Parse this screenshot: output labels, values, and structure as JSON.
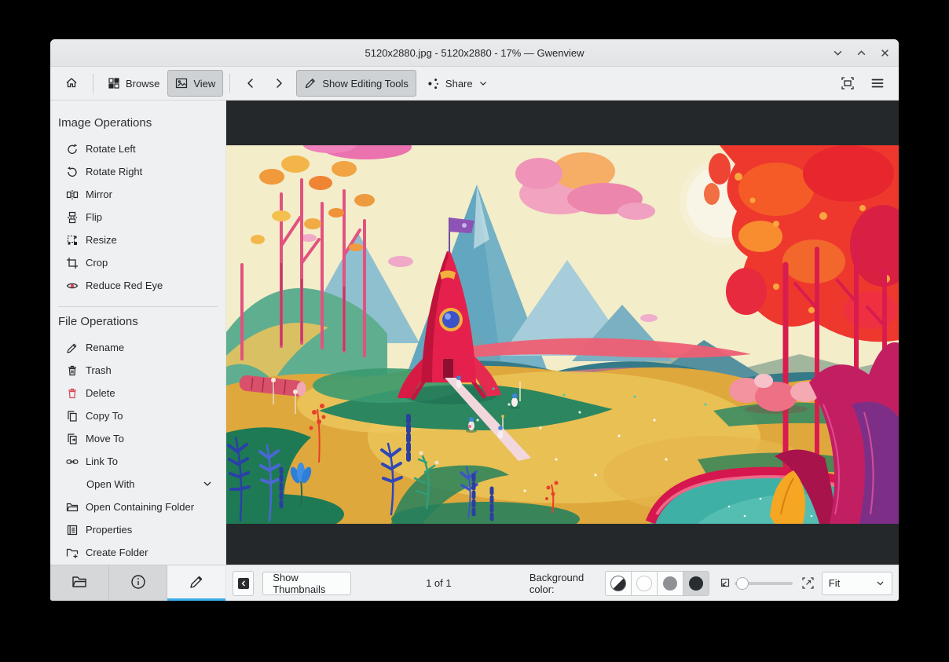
{
  "window": {
    "title": "5120x2880.jpg - 5120x2880 - 17% — Gwenview"
  },
  "toolbar": {
    "browse_label": "Browse",
    "view_label": "View",
    "editing_tools_label": "Show Editing Tools",
    "share_label": "Share"
  },
  "sidebar": {
    "image_operations": {
      "title": "Image Operations",
      "items": [
        {
          "label": "Rotate Left",
          "icon": "rotate-left-icon"
        },
        {
          "label": "Rotate Right",
          "icon": "rotate-right-icon"
        },
        {
          "label": "Mirror",
          "icon": "mirror-icon"
        },
        {
          "label": "Flip",
          "icon": "flip-icon"
        },
        {
          "label": "Resize",
          "icon": "resize-icon"
        },
        {
          "label": "Crop",
          "icon": "crop-icon"
        },
        {
          "label": "Reduce Red Eye",
          "icon": "reduce-red-eye-icon"
        }
      ]
    },
    "file_operations": {
      "title": "File Operations",
      "items": [
        {
          "label": "Rename",
          "icon": "rename-icon"
        },
        {
          "label": "Trash",
          "icon": "trash-icon"
        },
        {
          "label": "Delete",
          "icon": "delete-icon"
        },
        {
          "label": "Copy To",
          "icon": "copy-icon"
        },
        {
          "label": "Move To",
          "icon": "move-icon"
        },
        {
          "label": "Link To",
          "icon": "link-icon"
        },
        {
          "label": "Open With",
          "icon": "chevron-down-icon"
        },
        {
          "label": "Open Containing Folder",
          "icon": "folder-open-icon"
        },
        {
          "label": "Properties",
          "icon": "properties-icon"
        },
        {
          "label": "Create Folder",
          "icon": "create-folder-icon"
        }
      ]
    }
  },
  "statusbar": {
    "show_thumbnails_label": "Show Thumbnails",
    "page_indicator": "1 of 1",
    "background_color_label": "Background color:",
    "zoom_mode_value": "Fit"
  },
  "colors": {
    "accent": "#3daee9",
    "delete_red": "#da4453",
    "viewer_background": "#24282b",
    "chrome_background": "#eff0f1",
    "background_swatches": [
      "auto-half-black-white",
      "#ffffff",
      "#8f9294",
      "#2a2d30"
    ]
  },
  "icons": {
    "window": [
      "minimize-icon",
      "maximize-icon",
      "close-icon"
    ],
    "toolbar": [
      "home-icon",
      "browse-grid-icon",
      "view-image-icon",
      "back-icon",
      "forward-icon",
      "pencil-icon",
      "share-icon",
      "fit-screen-icon",
      "hamburger-icon"
    ],
    "statusbar": [
      "sidebar-toggle-icon",
      "zoom-fit-icon",
      "zoom-actual-icon",
      "chevron-down-icon"
    ],
    "sidebar_tabs": [
      "folder-icon",
      "info-icon",
      "pencil-icon"
    ]
  }
}
